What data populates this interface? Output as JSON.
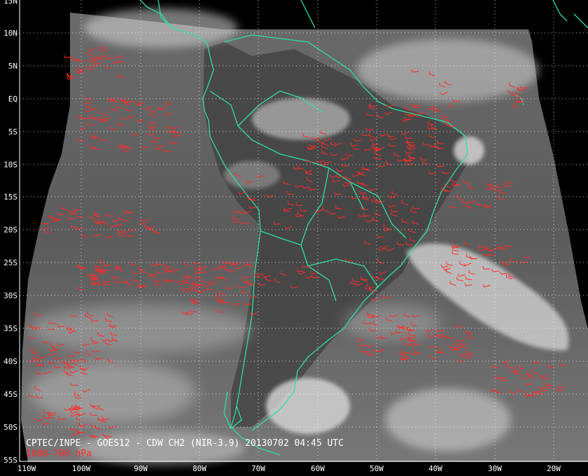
{
  "map": {
    "title": "CPTEC/INPE - GOES12 - CDW CH2 (NIR-3.9) 20130702 04:45 UTC",
    "layer_label": "1000-700 hPa",
    "colors": {
      "background": "#000000",
      "coastline": "#2fe0a0",
      "wind_barb": "#ff2a2a",
      "grid": "#ffffff",
      "label": "#ffffff"
    },
    "lat_labels": [
      "15N",
      "10N",
      "5N",
      "EQ",
      "5S",
      "10S",
      "15S",
      "20S",
      "25S",
      "30S",
      "35S",
      "40S",
      "45S",
      "50S",
      "55S"
    ],
    "lon_labels": [
      "110W",
      "100W",
      "90W",
      "80W",
      "70W",
      "60W",
      "50W",
      "40W",
      "30W",
      "20W"
    ]
  }
}
